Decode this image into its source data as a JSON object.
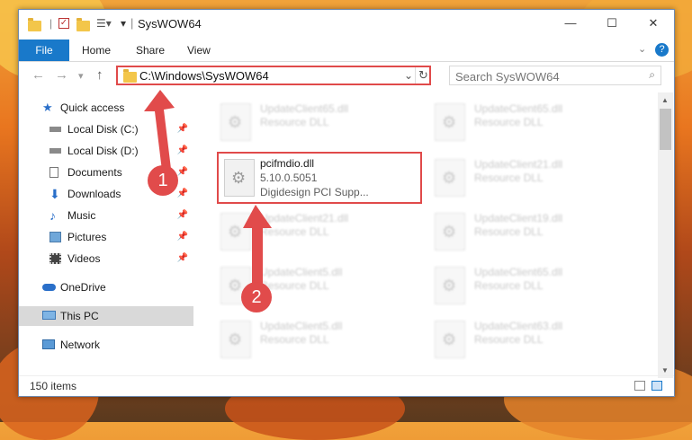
{
  "window": {
    "title": "SysWOW64",
    "controls": {
      "minimize": "—",
      "maximize": "☐",
      "close": "✕"
    }
  },
  "ribbon": {
    "tabs": [
      "File",
      "Home",
      "Share",
      "View"
    ],
    "help": "?"
  },
  "address": {
    "path": "C:\\Windows\\SysWOW64",
    "search_placeholder": "Search SysWOW64"
  },
  "sidebar": {
    "items": [
      {
        "label": "Quick access",
        "icon": "star-icon"
      },
      {
        "label": "Local Disk (C:)",
        "icon": "drive-icon",
        "pinned": true
      },
      {
        "label": "Local Disk (D:)",
        "icon": "drive-icon",
        "pinned": true
      },
      {
        "label": "Documents",
        "icon": "document-icon",
        "pinned": true
      },
      {
        "label": "Downloads",
        "icon": "download-icon",
        "pinned": true
      },
      {
        "label": "Music",
        "icon": "music-icon",
        "pinned": true
      },
      {
        "label": "Pictures",
        "icon": "pictures-icon",
        "pinned": true
      },
      {
        "label": "Videos",
        "icon": "video-icon",
        "pinned": true
      },
      {
        "label": "OneDrive",
        "icon": "cloud-icon"
      },
      {
        "label": "This PC",
        "icon": "computer-icon",
        "selected": true
      },
      {
        "label": "Network",
        "icon": "network-icon"
      }
    ]
  },
  "files": [
    {
      "name": "UpdateClient65.dll",
      "type": "Resource DLL"
    },
    {
      "name": "UpdateClient65.dll",
      "type": "Resource DLL"
    },
    {
      "name": "pcifmdio.dll",
      "version": "5.10.0.5051",
      "description": "Digidesign PCI Supp..."
    },
    {
      "name": "UpdateClient21.dll",
      "type": "Resource DLL"
    },
    {
      "name": "UpdateClient21.dll",
      "type": "Resource DLL"
    },
    {
      "name": "UpdateClient19.dll",
      "type": "Resource DLL"
    },
    {
      "name": "UpdateClient5.dll",
      "type": "Resource DLL"
    },
    {
      "name": "UpdateClient65.dll",
      "type": "Resource DLL"
    },
    {
      "name": "UpdateClient5.dll",
      "type": "Resource DLL"
    },
    {
      "name": "UpdateClient63.dll",
      "type": "Resource DLL"
    }
  ],
  "status": {
    "item_count": "150 items"
  },
  "annotations": {
    "step1": "1",
    "step2": "2"
  },
  "colors": {
    "accent": "#1979ca",
    "highlight": "#e04a4a"
  }
}
